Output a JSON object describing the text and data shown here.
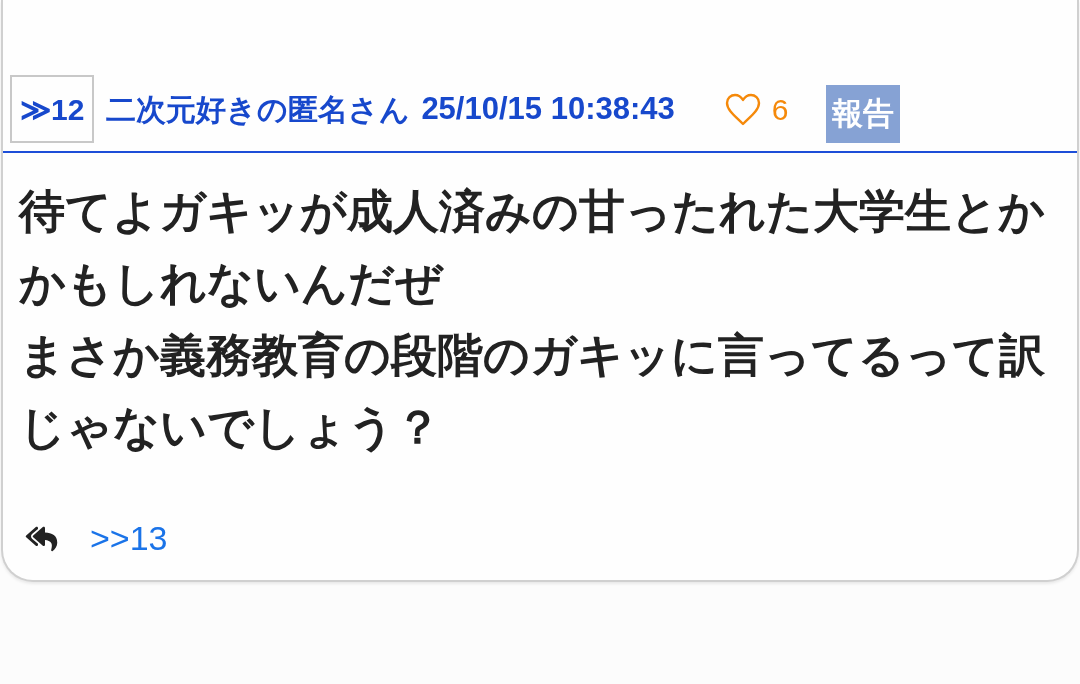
{
  "post": {
    "number": "≫12",
    "author": "二次元好きの匿名さん",
    "timestamp": "25/10/15 10:38:43",
    "likes": "6",
    "report_button": "報告",
    "body": [
      "待てよガキッが成人済みの甘ったれた大学生とかかもしれないんだぜ",
      "まさか義務教育の段階のガキッに言ってるって訳じゃないでしょう？"
    ],
    "replies": [
      ">>13"
    ]
  }
}
